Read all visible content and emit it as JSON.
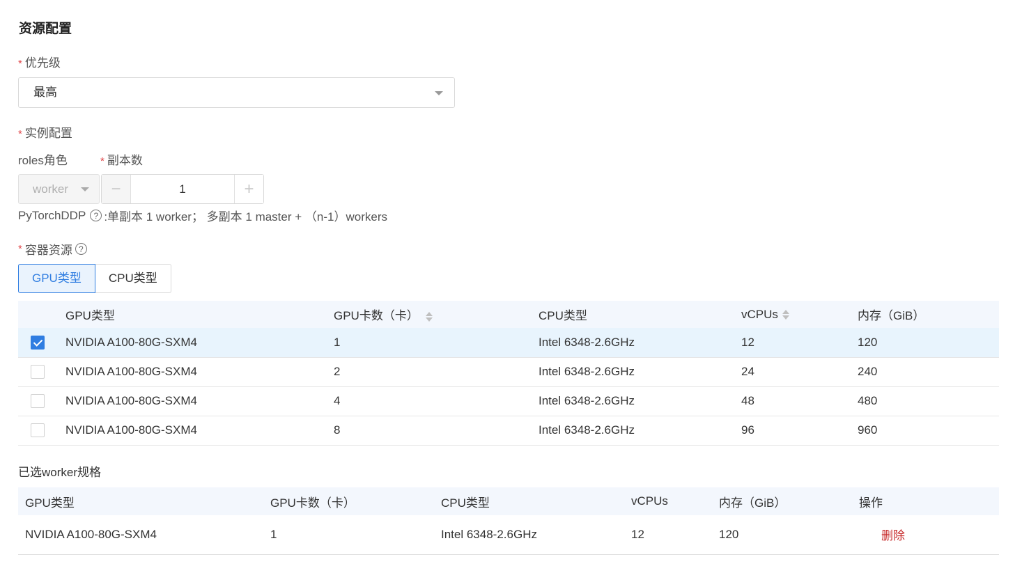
{
  "section_title": "资源配置",
  "priority": {
    "label": "优先级",
    "value": "最高"
  },
  "instance": {
    "label": "实例配置",
    "roles_label": "roles角色",
    "replicas_label": "副本数",
    "role_value": "worker",
    "replicas_value": "1",
    "hint_prefix": "PyTorchDDP",
    "hint_text": ":单副本 1 worker； 多副本 1 master + （n-1）workers"
  },
  "container": {
    "label": "容器资源",
    "tabs": [
      {
        "label": "GPU类型",
        "active": true
      },
      {
        "label": "CPU类型",
        "active": false
      }
    ]
  },
  "gpu_table": {
    "headers": {
      "gpu_type": "GPU类型",
      "gpu_count": "GPU卡数（卡）",
      "cpu_type": "CPU类型",
      "vcpus": "vCPUs",
      "memory": "内存（GiB）"
    },
    "rows": [
      {
        "checked": true,
        "gpu_type": "NVIDIA A100-80G-SXM4",
        "gpu_count": "1",
        "cpu_type": "Intel 6348-2.6GHz",
        "vcpus": "12",
        "memory": "120"
      },
      {
        "checked": false,
        "gpu_type": "NVIDIA A100-80G-SXM4",
        "gpu_count": "2",
        "cpu_type": "Intel 6348-2.6GHz",
        "vcpus": "24",
        "memory": "240"
      },
      {
        "checked": false,
        "gpu_type": "NVIDIA A100-80G-SXM4",
        "gpu_count": "4",
        "cpu_type": "Intel 6348-2.6GHz",
        "vcpus": "48",
        "memory": "480"
      },
      {
        "checked": false,
        "gpu_type": "NVIDIA A100-80G-SXM4",
        "gpu_count": "8",
        "cpu_type": "Intel 6348-2.6GHz",
        "vcpus": "96",
        "memory": "960"
      }
    ]
  },
  "selected": {
    "title": "已选worker规格",
    "headers": {
      "gpu_type": "GPU类型",
      "gpu_count": "GPU卡数（卡）",
      "cpu_type": "CPU类型",
      "vcpus": "vCPUs",
      "memory": "内存（GiB）",
      "action": "操作"
    },
    "row": {
      "gpu_type": "NVIDIA A100-80G-SXM4",
      "gpu_count": "1",
      "cpu_type": "Intel 6348-2.6GHz",
      "vcpus": "12",
      "memory": "120",
      "action": "删除"
    }
  },
  "icons": {
    "help": "question-circle-icon",
    "dropdown": "caret-down-icon",
    "check": "check-icon",
    "sort": "sort-icon"
  },
  "colors": {
    "primary": "#2f7de1",
    "required": "#e0474a",
    "danger": "#c62828",
    "header_bg": "#f3f7fd",
    "selected_row_bg": "#e8f4fd"
  }
}
